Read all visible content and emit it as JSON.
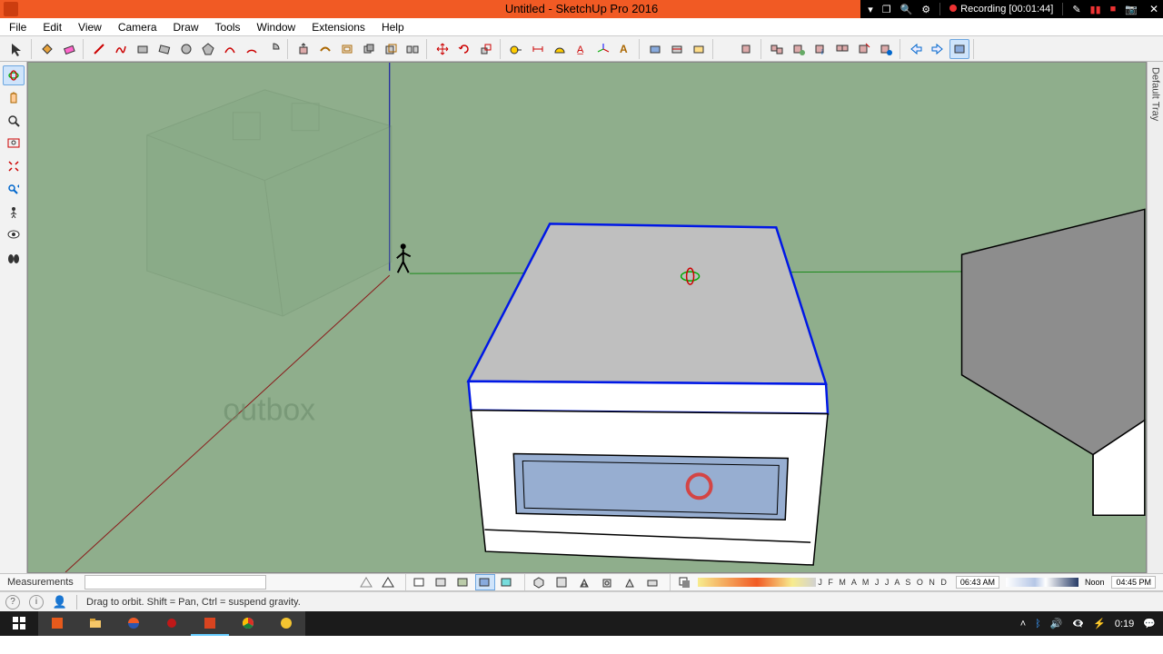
{
  "title": "Untitled - SketchUp Pro 2016",
  "recording": {
    "label": "Recording",
    "elapsed": "[00:01:44]"
  },
  "menu": {
    "file": "File",
    "edit": "Edit",
    "view": "View",
    "camera": "Camera",
    "draw": "Draw",
    "tools": "Tools",
    "window": "Window",
    "extensions": "Extensions",
    "help": "Help"
  },
  "right_tray": "Default Tray",
  "measurements_label": "Measurements",
  "months": "J F M A M J J A S O N D",
  "time1": "06:43 AM",
  "time_noon": "Noon",
  "time2": "04:45 PM",
  "hint": "Drag to orbit. Shift = Pan, Ctrl = suspend gravity.",
  "watermark": "outbox",
  "clock": "0:19",
  "win": {
    "tri1": "▾",
    "sq": "❐",
    "mag": "🔍",
    "gear": "⚙"
  },
  "icons": {
    "select": "↖",
    "paint": "🪣",
    "eraser": "◧",
    "line": "╱",
    "free": "∿",
    "rect": "▭",
    "rotrect": "◇",
    "circle": "○",
    "poly": "⬠",
    "arc": "◡",
    "pie": "◔",
    "pushpull": "⇕",
    "follow": "↝",
    "offset": "◎",
    "move": "✥",
    "rotate": "⟳",
    "scale": "⤢",
    "tape": "📏",
    "dim": "↔",
    "protractor": "◗",
    "text": "T",
    "axes": "✛",
    "3dtext": "Ŧ",
    "orbit": "⟲",
    "pan": "✋",
    "zoom": "🔍",
    "zoomwin": "⧉",
    "zoomext": "⤢",
    "prev": "↶",
    "position": "👁",
    "look": "👀",
    "walk": "🚶",
    "component": "📦",
    "outliner": "◫"
  },
  "taskbar_icons": {
    "start": "⊞",
    "explorer": "🗂",
    "firefox": "🦊",
    "red": "●",
    "sketchup": "S",
    "chrome": "◯",
    "other": "◌"
  }
}
